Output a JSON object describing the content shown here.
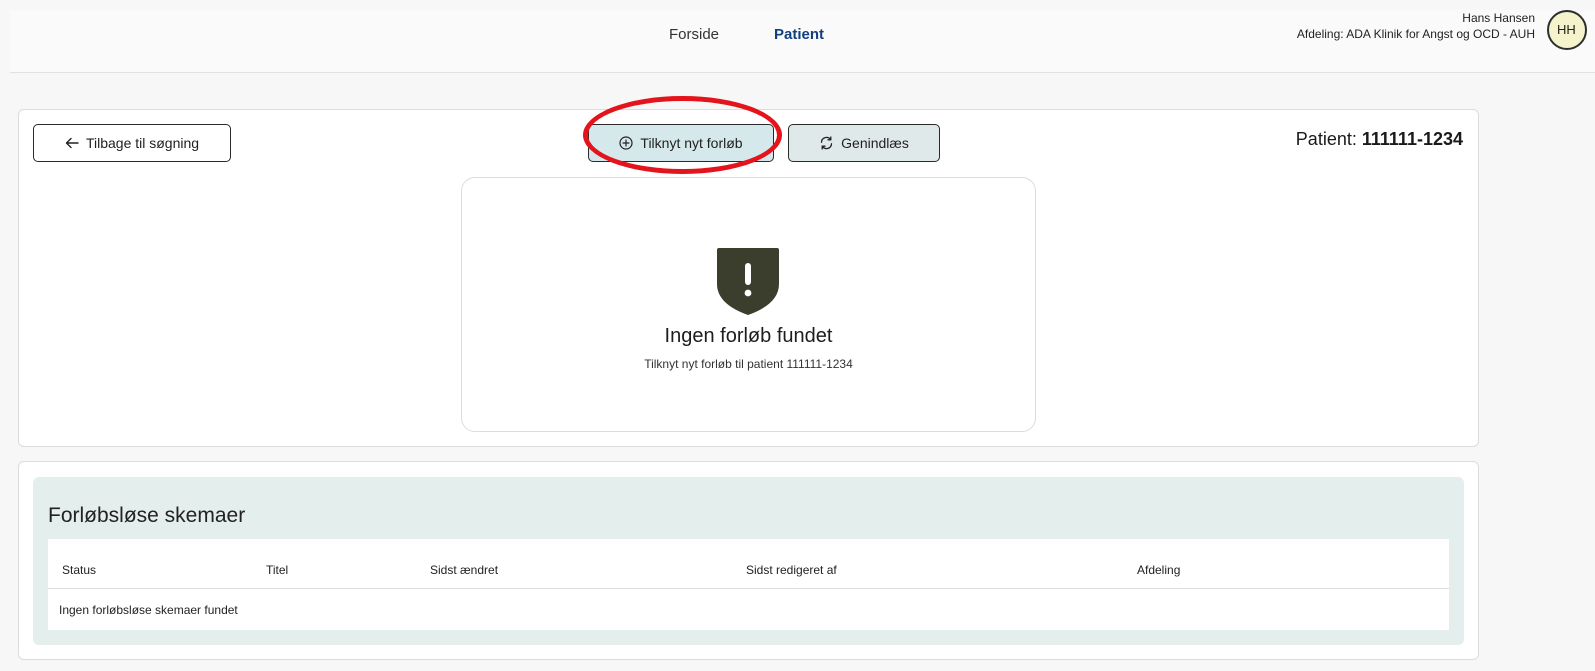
{
  "header": {
    "nav": [
      {
        "label": "Forside",
        "active": false
      },
      {
        "label": "Patient",
        "active": true
      }
    ],
    "user_name": "Hans Hansen",
    "department_line": "Afdeling: ADA Klinik for Angst og OCD - AUH",
    "avatar_initials": "HH"
  },
  "toolbar": {
    "back_label": "Tilbage til søgning",
    "add_course_label": "Tilknyt nyt forløb",
    "reload_label": "Genindlæs"
  },
  "patient": {
    "label": "Patient:",
    "cpr": "111111-1234"
  },
  "empty_state": {
    "title": "Ingen forløb fundet",
    "subtitle": "Tilknyt nyt forløb til patient 111111-1234"
  },
  "orphan_forms": {
    "title": "Forløbsløse skemaer",
    "columns": [
      "Status",
      "Titel",
      "Sidst ændret",
      "Sidst redigeret af",
      "Afdeling"
    ],
    "empty_message": "Ingen forløbsløse skemaer fundet"
  },
  "colors": {
    "nav_active": "#123f80",
    "primary_button_bg": "#d5e8ec",
    "highlight": "#e3141b",
    "shield": "#3b3d2d",
    "panel_bg": "#e4eeed"
  }
}
